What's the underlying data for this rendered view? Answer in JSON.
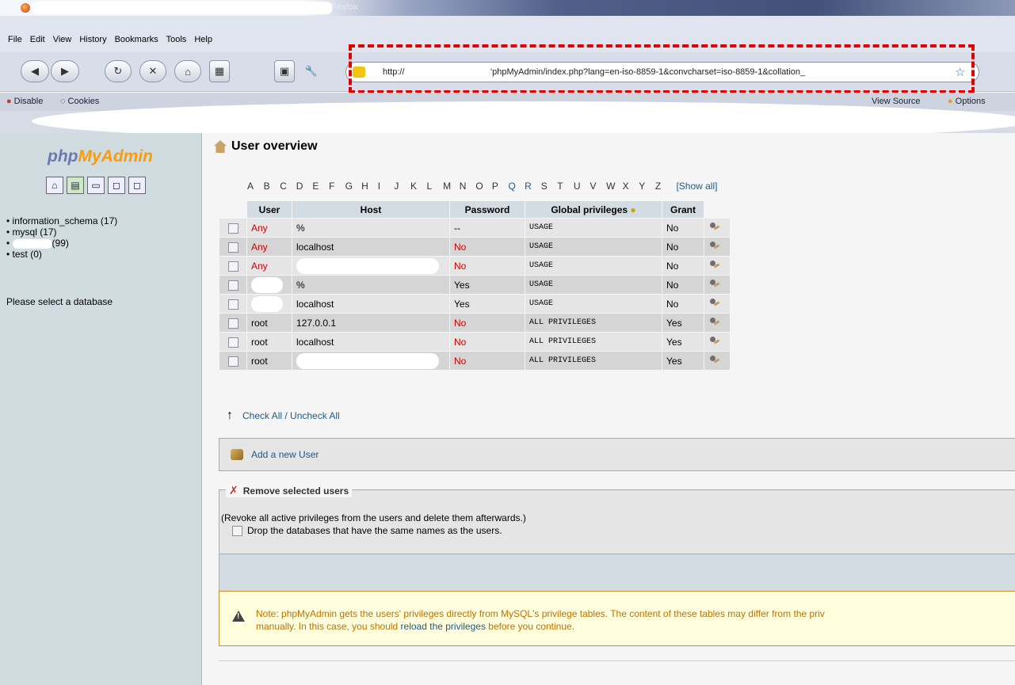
{
  "browser": {
    "title": "Firefox",
    "menu": [
      "File",
      "Edit",
      "View",
      "History",
      "Bookmarks",
      "Tools",
      "Help"
    ],
    "url_protocol": "http://",
    "url_path": "'phpMyAdmin/index.php?lang=en-iso-8859-1&convcharset=iso-8859-1&collation_",
    "toolbar": {
      "disable_label": "Disable",
      "cookies_label": "Cookies",
      "view_source_label": "View Source",
      "options_label": "Options"
    }
  },
  "sidebar": {
    "logo": {
      "php": "php",
      "my": "My",
      "admin": "Admin"
    },
    "databases": [
      {
        "label": "information_schema (17)"
      },
      {
        "label": "mysql (17)"
      },
      {
        "label": "(99)"
      },
      {
        "label": "test (0)"
      }
    ],
    "prompt": "Please select a database"
  },
  "main": {
    "title": "User overview",
    "alphabet": [
      "A",
      "B",
      "C",
      "D",
      "E",
      "F",
      "G",
      "H",
      "I",
      "J",
      "K",
      "L",
      "M",
      "N",
      "O",
      "P",
      "Q",
      "R",
      "S",
      "T",
      "U",
      "V",
      "W",
      "X",
      "Y",
      "Z"
    ],
    "show_all": "[Show all]",
    "columns": {
      "user": "User",
      "host": "Host",
      "password": "Password",
      "privileges": "Global privileges",
      "grant": "Grant"
    },
    "rows": [
      {
        "user": "Any",
        "host": "%",
        "password": "--",
        "privileges": "USAGE",
        "grant": "No"
      },
      {
        "user": "Any",
        "host": "localhost",
        "password": "No",
        "privileges": "USAGE",
        "grant": "No"
      },
      {
        "user": "Any",
        "host": "",
        "password": "No",
        "privileges": "USAGE",
        "grant": "No"
      },
      {
        "user": "",
        "host": "%",
        "password": "Yes",
        "privileges": "USAGE",
        "grant": "No"
      },
      {
        "user": "",
        "host": "localhost",
        "password": "Yes",
        "privileges": "USAGE",
        "grant": "No"
      },
      {
        "user": "root",
        "host": "127.0.0.1",
        "password": "No",
        "privileges": "ALL PRIVILEGES",
        "grant": "Yes"
      },
      {
        "user": "root",
        "host": "localhost",
        "password": "No",
        "privileges": "ALL PRIVILEGES",
        "grant": "Yes"
      },
      {
        "user": "root",
        "host": "",
        "password": "No",
        "privileges": "ALL PRIVILEGES",
        "grant": "Yes"
      }
    ],
    "check_all": "Check All / Uncheck All",
    "add_user": "Add a new User",
    "remove": {
      "legend": "Remove selected users",
      "description": "(Revoke all active privileges from the users and delete them afterwards.)",
      "drop_label": "Drop the databases that have the same names as the users."
    },
    "notice": {
      "line1": "Note: phpMyAdmin gets the users' privileges directly from MySQL's privilege tables. The content of these tables may differ from the priv",
      "line2_pre": "manually. In this case, you should ",
      "line2_link": "reload the privileges",
      "line2_post": " before you continue."
    }
  }
}
